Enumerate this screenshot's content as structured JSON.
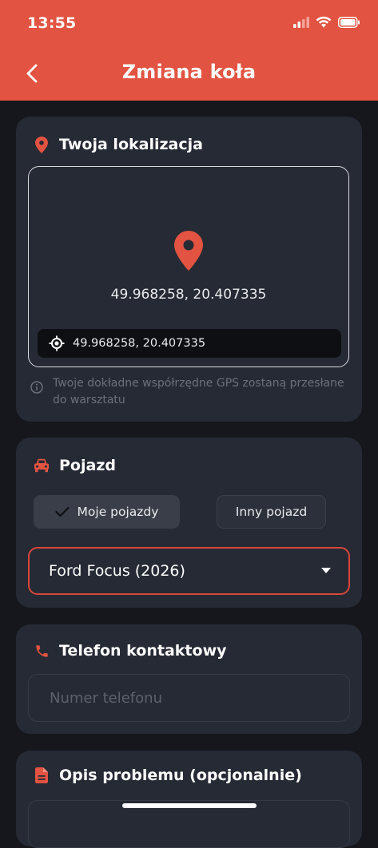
{
  "status": {
    "time": "13:55"
  },
  "header": {
    "title": "Zmiana koła"
  },
  "location": {
    "title": "Twoja lokalizacja",
    "coordinates": "49.968258, 20.407335",
    "coordinates_bar": "49.968258, 20.407335",
    "note": "Twoje dokładne współrzędne GPS zostaną przesłane do warsztatu"
  },
  "vehicle": {
    "title": "Pojazd",
    "my_vehicles_label": "Moje pojazdy",
    "other_vehicle_label": "Inny pojazd",
    "selected_vehicle": "Ford Focus (2026)"
  },
  "phone": {
    "title": "Telefon kontaktowy",
    "placeholder": "Numer telefonu"
  },
  "description": {
    "title": "Opis problemu (opcjonalnie)"
  },
  "colors": {
    "accent": "#e25341",
    "card": "#262a34",
    "background": "#15171c"
  }
}
